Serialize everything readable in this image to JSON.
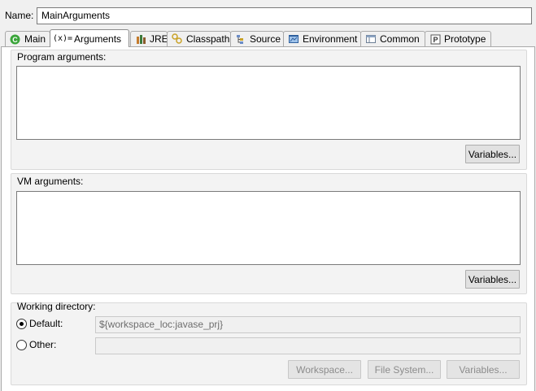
{
  "name": {
    "label": "Name:",
    "value": "MainArguments"
  },
  "tabs": [
    {
      "label": "Main",
      "icon": "main-class-icon"
    },
    {
      "label": "Arguments",
      "icon": "arguments-icon",
      "active": true
    },
    {
      "label": "JRE",
      "icon": "jre-icon"
    },
    {
      "label": "Classpath",
      "icon": "classpath-icon"
    },
    {
      "label": "Source",
      "icon": "source-icon"
    },
    {
      "label": "Environment",
      "icon": "environment-icon"
    },
    {
      "label": "Common",
      "icon": "common-icon"
    },
    {
      "label": "Prototype",
      "icon": "prototype-icon"
    }
  ],
  "tab_icon_glyphs": {
    "main": "C",
    "arguments": "(x)=",
    "prototype": "P"
  },
  "program_arguments": {
    "title": "Program arguments:",
    "value": "",
    "variables_button": "Variables..."
  },
  "vm_arguments": {
    "title": "VM arguments:",
    "value": "",
    "variables_button": "Variables..."
  },
  "working_directory": {
    "title": "Working directory:",
    "default_label": "Default:",
    "default_value": "${workspace_loc:javase_prj}",
    "default_selected": true,
    "other_label": "Other:",
    "other_value": "",
    "workspace_button": "Workspace...",
    "file_system_button": "File System...",
    "variables_button": "Variables..."
  },
  "colors": {
    "window_bg": "#f0f0f0",
    "panel_bg": "#ffffff",
    "main_icon_green": "#3aa53a",
    "jre_icon_brown": "#8a5a2b",
    "environment_icon_blue": "#2e5f9e"
  }
}
